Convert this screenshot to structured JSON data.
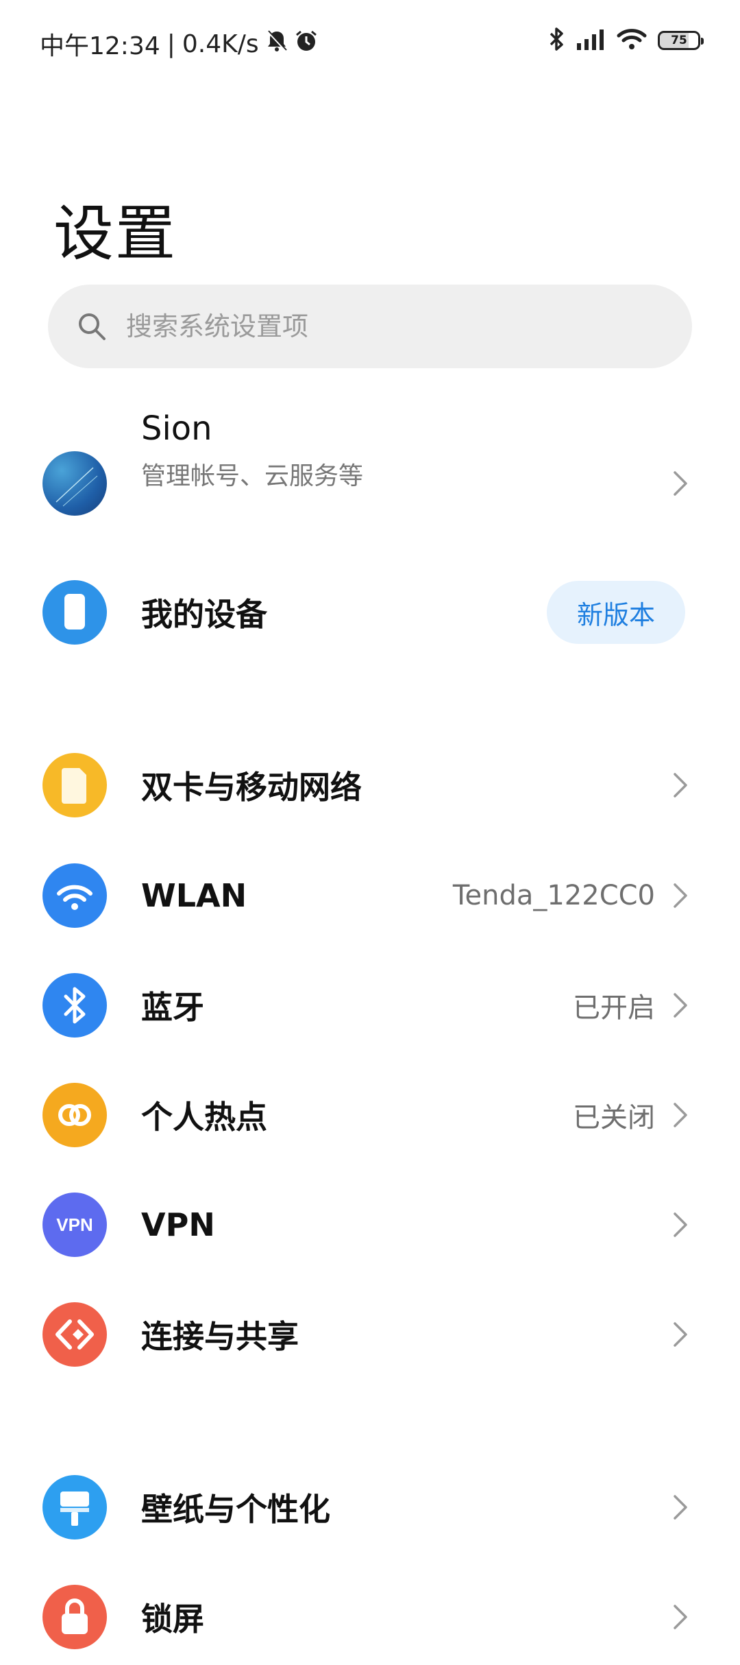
{
  "status": {
    "time": "中午12:34",
    "speed": "0.4K/s",
    "separator": "|",
    "battery": "75"
  },
  "title": "设置",
  "search": {
    "placeholder": "搜索系统设置项"
  },
  "account": {
    "name": "Sion",
    "subtitle": "管理帐号、云服务等"
  },
  "device": {
    "label": "我的设备",
    "badge": "新版本"
  },
  "items": [
    {
      "label": "双卡与移动网络",
      "value": ""
    },
    {
      "label": "WLAN",
      "value": "Tenda_122CC0"
    },
    {
      "label": "蓝牙",
      "value": "已开启"
    },
    {
      "label": "个人热点",
      "value": "已关闭"
    },
    {
      "label": "VPN",
      "value": "",
      "icon_text": "VPN"
    },
    {
      "label": "连接与共享",
      "value": ""
    },
    {
      "label": "壁纸与个性化",
      "value": ""
    },
    {
      "label": "锁屏",
      "value": ""
    }
  ],
  "colors": {
    "sim": "#f7b928",
    "wlan": "#2f86f0",
    "bluetooth": "#2f86f0",
    "hotspot": "#f5a91f",
    "vpn": "#5d6bef",
    "share": "#f0604a",
    "wallpaper": "#2d9ff0",
    "lock": "#f0604a"
  }
}
